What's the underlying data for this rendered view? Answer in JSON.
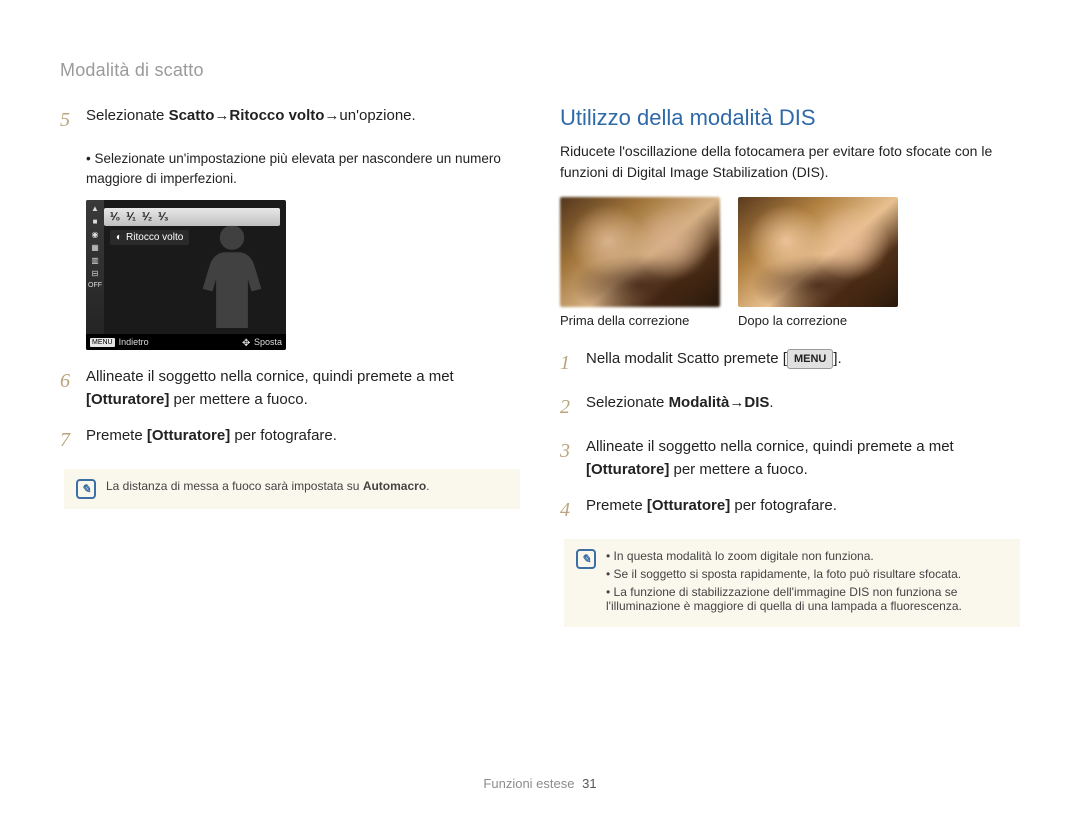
{
  "breadcrumb": "Modalità di scatto",
  "left": {
    "step5_intro": "Selezionate ",
    "step5_b1": "Scatto",
    "step5_arrow1": " → ",
    "step5_b2": "Ritocco volto",
    "step5_arrow2": " → ",
    "step5_tail": "un'opzione.",
    "sub5": "Selezionate un'impostazione più elevata per nascondere un numero maggiore di imperfezioni.",
    "lcd": {
      "label": "Ritocco volto",
      "back_label": "Indietro",
      "move_label": "Sposta",
      "menu_chip": "MENU",
      "topbar": [
        "⅟₀",
        "⅟₁",
        "⅟₂",
        "⅟₃"
      ]
    },
    "step6_a": "Allineate il soggetto nella cornice, quindi premete a met ",
    "step6_b": "[Otturatore]",
    "step6_c": " per mettere a fuoco.",
    "step7_a": "Premete ",
    "step7_b": "[Otturatore]",
    "step7_c": " per fotografare.",
    "note": "La distanza di messa a fuoco sarà impostata su ",
    "note_b": "Automacro",
    "note_tail": "."
  },
  "right": {
    "title": "Utilizzo della modalità DIS",
    "desc": "Riducete l'oscillazione della fotocamera per evitare foto sfocate con le funzioni di Digital Image Stabilization (DIS).",
    "cap_before": "Prima della correzione",
    "cap_after": "Dopo la correzione",
    "step1_a": "Nella modalit  Scatto premete [",
    "step1_btn": "MENU",
    "step1_b": "].",
    "step2_a": "Selezionate ",
    "step2_b1": "Modalità",
    "step2_arrow": " → ",
    "step2_b2": "DIS",
    "step2_tail": ".",
    "step3_a": "Allineate il soggetto nella cornice, quindi premete a met ",
    "step3_b": "[Otturatore]",
    "step3_c": " per mettere a fuoco.",
    "step4_a": "Premete ",
    "step4_b": "[Otturatore]",
    "step4_c": " per fotografare.",
    "note_items": [
      "In questa modalità lo zoom digitale non funziona.",
      "Se il soggetto si sposta rapidamente, la foto può risultare sfocata.",
      "La funzione di stabilizzazione dell'immagine DIS non funziona se l'illuminazione è maggiore di quella di una lampada a fluorescenza."
    ]
  },
  "footer_label": "Funzioni estese",
  "footer_page": "31"
}
